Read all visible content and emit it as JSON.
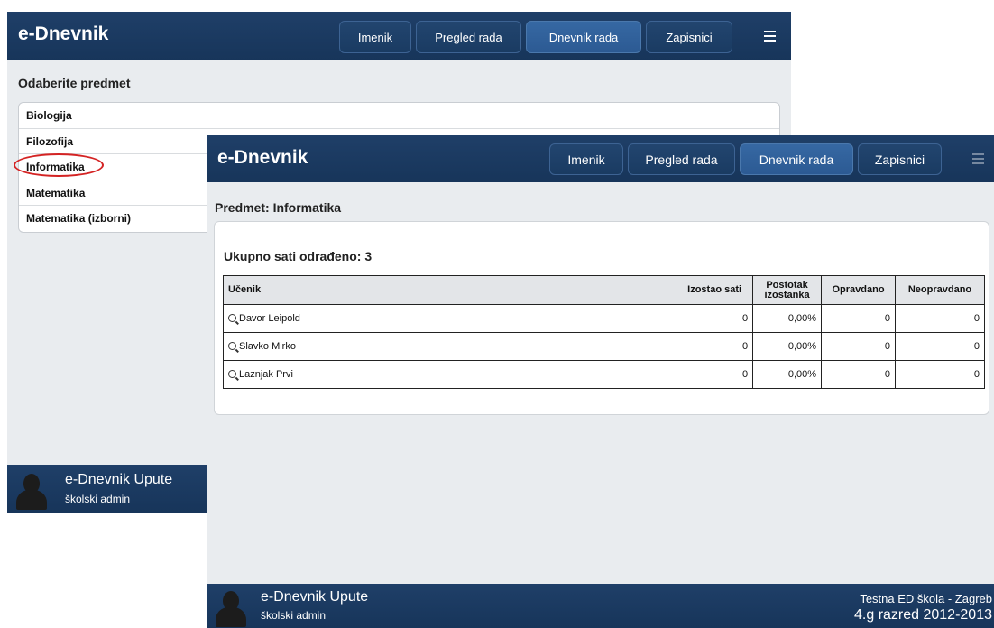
{
  "back_window": {
    "brand": "e-Dnevnik",
    "nav": [
      "Imenik",
      "Pregled rada",
      "Dnevnik rada",
      "Zapisnici"
    ],
    "active_nav": "Dnevnik rada",
    "heading": "Odaberite predmet",
    "subjects": [
      "Biologija",
      "Filozofija",
      "Informatika",
      "Matematika",
      "Matematika (izborni)"
    ],
    "highlighted_subject": "Informatika",
    "footer": {
      "title": "e-Dnevnik Upute",
      "subtitle": "školski admin"
    }
  },
  "front_window": {
    "brand": "e-Dnevnik",
    "nav": [
      "Imenik",
      "Pregled rada",
      "Dnevnik rada",
      "Zapisnici"
    ],
    "active_nav": "Dnevnik rada",
    "heading": "Predmet: Informatika",
    "total_label": "Ukupno sati odrađeno: 3",
    "table": {
      "columns": [
        "Učenik",
        "Izostao sati",
        "Postotak izostanka",
        "Opravdano",
        "Neopravdano"
      ],
      "rows": [
        [
          "Davor Leipold",
          "0",
          "0,00%",
          "0",
          "0"
        ],
        [
          "Slavko Mirko",
          "0",
          "0,00%",
          "0",
          "0"
        ],
        [
          "Laznjak Prvi",
          "0",
          "0,00%",
          "0",
          "0"
        ]
      ]
    },
    "footer": {
      "title": "e-Dnevnik Upute",
      "subtitle": "školski admin",
      "school": "Testna ED škola - Zagreb",
      "class": "4.g razred 2012-2013"
    }
  },
  "colors": {
    "header": "#1b3a60",
    "active_button": "#2f5e97",
    "background": "#e9ecef",
    "highlight_circle": "#d42323"
  }
}
